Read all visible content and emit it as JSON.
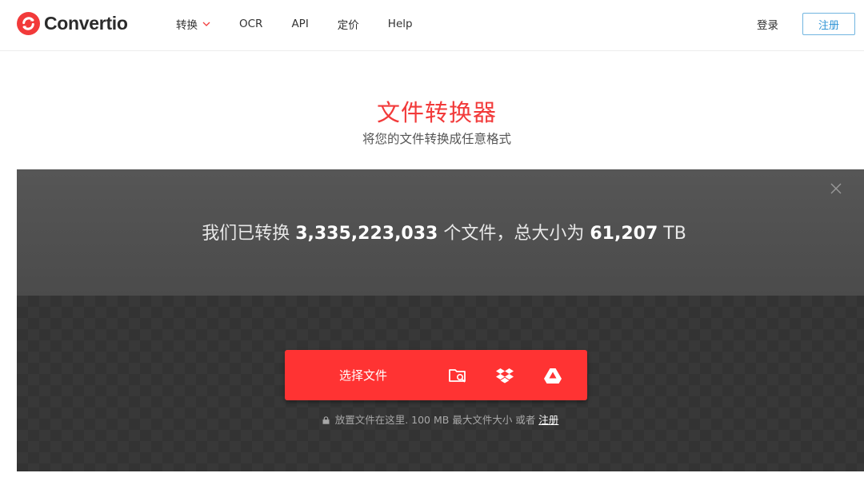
{
  "brand": {
    "name": "Convertio",
    "color": "#f23a3a"
  },
  "nav": {
    "items": [
      {
        "label": "转换",
        "has_dropdown": true
      },
      {
        "label": "OCR"
      },
      {
        "label": "API"
      },
      {
        "label": "定价"
      },
      {
        "label": "Help"
      }
    ],
    "login": "登录",
    "register": "注册"
  },
  "hero": {
    "title": "文件转换器",
    "subtitle": "将您的文件转换成任意格式"
  },
  "stats": {
    "prefix": "我们已转换",
    "files_count": "3,335,223,033",
    "middle": "个文件，总大小为",
    "total_size": "61,207",
    "unit": "TB"
  },
  "uploader": {
    "choose_label": "选择文件",
    "sources": [
      "folder-search-icon",
      "dropbox-icon",
      "google-drive-icon"
    ],
    "drop_note": "放置文件在这里. 100 MB 最大文件大小 或者",
    "drop_note_link": "注册",
    "accent": "#ff3333"
  }
}
